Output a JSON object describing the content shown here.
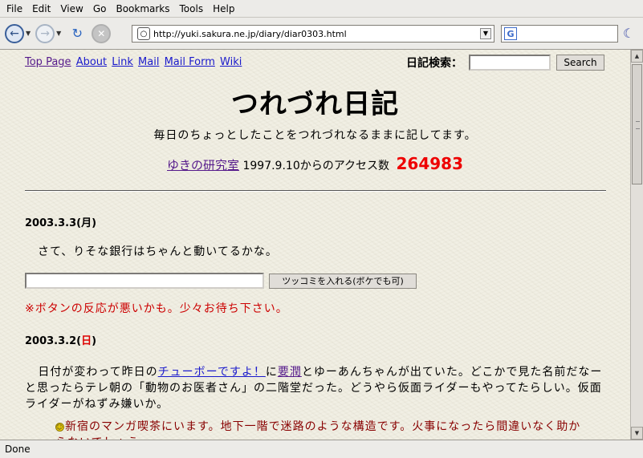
{
  "menu": [
    "File",
    "Edit",
    "View",
    "Go",
    "Bookmarks",
    "Tools",
    "Help"
  ],
  "toolbar": {
    "back_icon": "back-arrow-icon",
    "forward_icon": "forward-arrow-icon",
    "reload_icon": "reload-icon",
    "stop_icon": "stop-icon",
    "url": "http://yuki.sakura.ne.jp/diary/diar0303.html",
    "search_value": ""
  },
  "page": {
    "nav_links": [
      "Top Page",
      "About",
      "Link",
      "Mail",
      "Mail Form",
      "Wiki"
    ],
    "diary_search_label": "日記検索：",
    "search_button": "Search",
    "title": "つれづれ日記",
    "subtitle": "毎日のちょっとしたことをつれづれなるままに記してます。",
    "lab_link": "ゆきの研究室",
    "counter_text": "1997.9.10からのアクセス数",
    "counter_value": "264983",
    "entries": [
      {
        "date": "2003.3.3(月)",
        "text": "さて、りそな銀行はちゃんと動いてるかな。"
      },
      {
        "date_prefix": "2003.3.2(",
        "date_day": "日",
        "date_suffix": ")",
        "text_1": "日付が変わって昨日の",
        "link_1": "チューボーですよ！",
        "text_2": "に",
        "link_2": "要潤",
        "text_3": "とゆーあんちゃんが出ていた。どこかで見た名前だなーと思ったらテレ朝の「動物のお医者さん」の二階堂だった。どうやら仮面ライダーもやってたらしい。仮面ライダーがねずみ嫌いか。",
        "text_4": "新宿のマンガ喫茶にいます。地下一階で迷路のような構造です。火事になったら間違いなく助からないでしょう。"
      }
    ],
    "tsukkomi_button": "ツッコミを入れる(ボケでも可)",
    "warning": "※ボタンの反応が悪いかも。少々お待ち下さい。"
  },
  "status": "Done"
}
